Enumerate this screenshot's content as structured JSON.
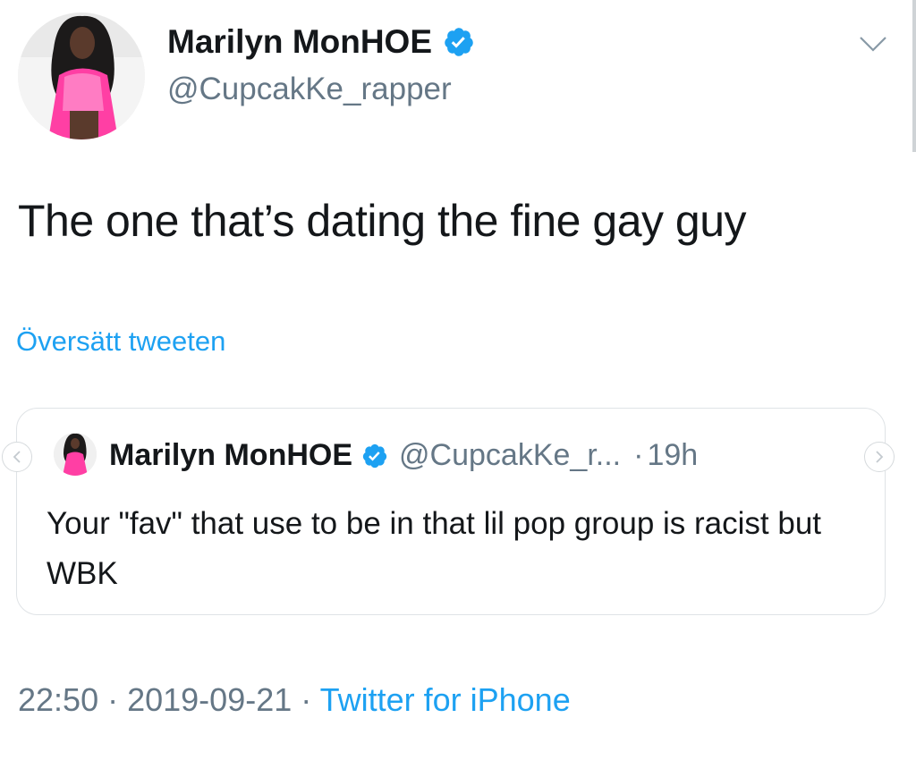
{
  "author": {
    "name": "Marilyn MonHOE",
    "handle": "@CupcakKe_rapper",
    "verified": true
  },
  "tweet": {
    "text": "The one that’s dating the fine gay guy",
    "translate_label": "Översätt tweeten"
  },
  "quoted": {
    "name": "Marilyn MonHOE",
    "handle": "@CupcakKe_r...",
    "separator": "·",
    "time": "19h",
    "text": "Your \"fav\" that use to be in that lil pop group is racist but WBK"
  },
  "footer": {
    "time": "22:50",
    "dot1": " · ",
    "date": "2019-09-21",
    "dot2": " · ",
    "source": "Twitter for iPhone"
  },
  "icons": {
    "verified": "verified-badge-icon",
    "menu": "chevron-down-icon",
    "prev": "chevron-left-icon",
    "next": "chevron-right-icon"
  },
  "colors": {
    "accent": "#1da1f2",
    "muted": "#657786",
    "text": "#14171a",
    "border": "#dfe3e6"
  }
}
